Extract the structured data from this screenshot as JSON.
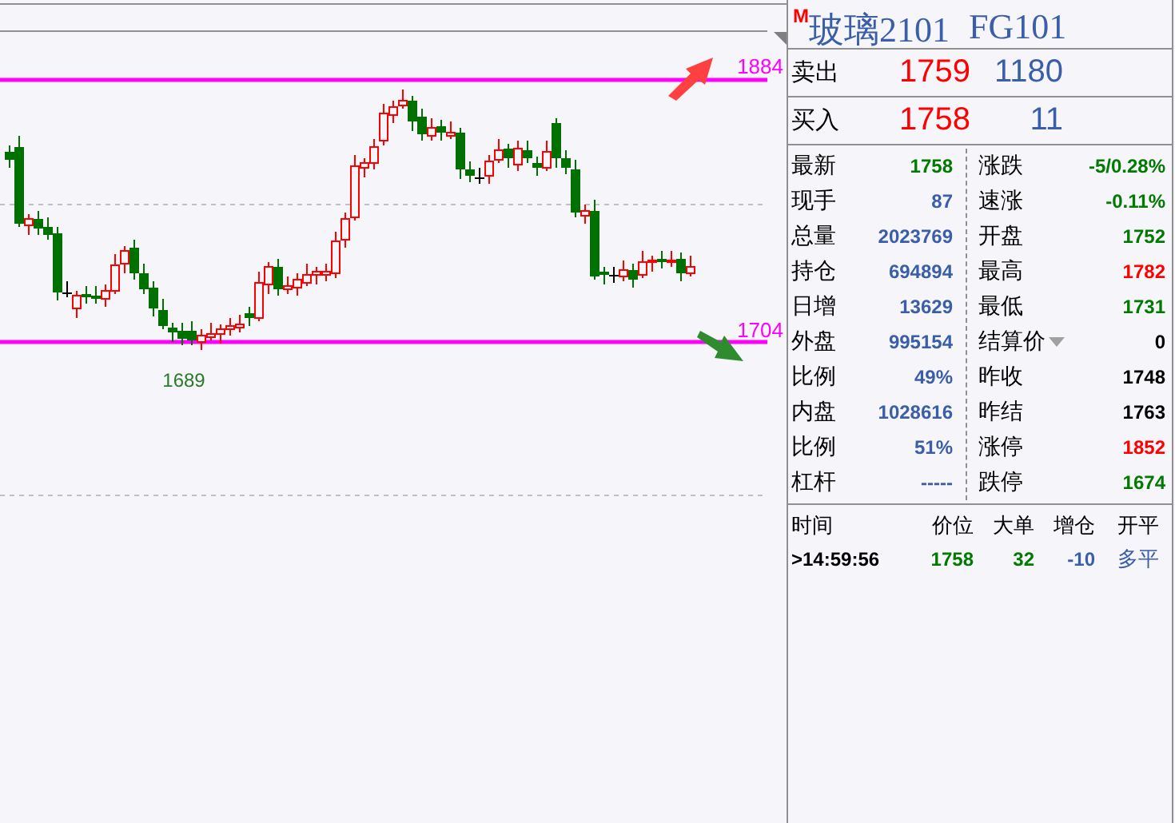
{
  "chart": {
    "resistance": {
      "label": "1884"
    },
    "support": {
      "label": "1704"
    },
    "low_label": "1689"
  },
  "quote": {
    "marker": "M",
    "name": "玻璃2101",
    "code": "FG101",
    "ask": {
      "label": "卖出",
      "price": "1759",
      "volume": "1180"
    },
    "bid": {
      "label": "买入",
      "price": "1758",
      "volume": "11"
    },
    "stats_left": [
      {
        "label": "最新",
        "value": "1758",
        "color": "#007a00"
      },
      {
        "label": "现手",
        "value": "87",
        "color": "#3a5ea8"
      },
      {
        "label": "总量",
        "value": "2023769",
        "color": "#3a5ea8"
      },
      {
        "label": "持仓",
        "value": "694894",
        "color": "#3a5ea8"
      },
      {
        "label": "日增",
        "value": "13629",
        "color": "#3a5ea8"
      },
      {
        "label": "外盘",
        "value": "995154",
        "color": "#3a5ea8"
      },
      {
        "label": "比例",
        "value": "49%",
        "color": "#3a5ea8"
      },
      {
        "label": "内盘",
        "value": "1028616",
        "color": "#3a5ea8"
      },
      {
        "label": "比例",
        "value": "51%",
        "color": "#3a5ea8"
      },
      {
        "label": "杠杆",
        "value": "-----",
        "color": "#3a5ea8"
      }
    ],
    "stats_right": [
      {
        "label": "涨跌",
        "value": "-5/0.28%",
        "color": "#007a00"
      },
      {
        "label": "速涨",
        "value": "-0.11%",
        "color": "#007a00"
      },
      {
        "label": "开盘",
        "value": "1752",
        "color": "#007a00"
      },
      {
        "label": "最高",
        "value": "1782",
        "color": "#ff0000"
      },
      {
        "label": "最低",
        "value": "1731",
        "color": "#007a00"
      },
      {
        "label": "结算价",
        "value": "0",
        "color": "#000000",
        "dropdown": true
      },
      {
        "label": "昨收",
        "value": "1748",
        "color": "#000000"
      },
      {
        "label": "昨结",
        "value": "1763",
        "color": "#000000"
      },
      {
        "label": "涨停",
        "value": "1852",
        "color": "#ff0000"
      },
      {
        "label": "跌停",
        "value": "1674",
        "color": "#007a00"
      }
    ],
    "ticks": {
      "columns": [
        "时间",
        "价位",
        "大单",
        "增仓",
        "开平"
      ],
      "rows": [
        {
          "cells": [
            {
              "text": ">14:59:56",
              "color": "#000000"
            },
            {
              "text": "1758",
              "color": "#007a00"
            },
            {
              "text": "32",
              "color": "#007a00"
            },
            {
              "text": "-10",
              "color": "#3a5ea8"
            },
            {
              "text": "多平",
              "color": "#3a5ea8"
            }
          ]
        }
      ]
    }
  }
}
